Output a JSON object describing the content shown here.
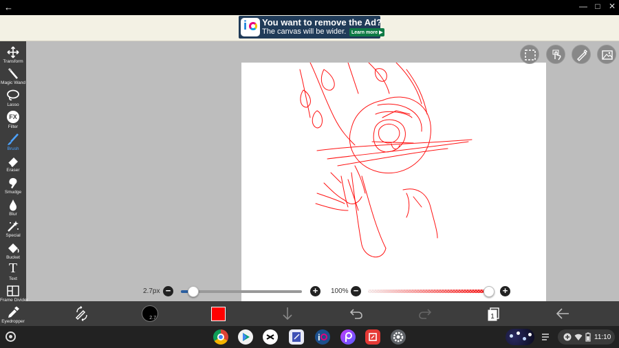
{
  "titlebar": {
    "back_glyph": "←",
    "minimize_glyph": "—",
    "maximize_glyph": "□",
    "close_glyph": "✕"
  },
  "ad": {
    "headline": "You want to remove the Ad?",
    "subline": "The canvas will be wider.",
    "cta": "Learn more ▶",
    "logo_letter": "i"
  },
  "tools": [
    {
      "label": "Transform",
      "icon": "move-arrows-icon",
      "active": false
    },
    {
      "label": "Magic Wand",
      "icon": "magic-wand-icon",
      "active": false
    },
    {
      "label": "Lasso",
      "icon": "lasso-icon",
      "active": false
    },
    {
      "label": "Filter",
      "icon": "fx-icon",
      "active": false
    },
    {
      "label": "Brush",
      "icon": "brush-icon",
      "active": true
    },
    {
      "label": "Eraser",
      "icon": "eraser-icon",
      "active": false
    },
    {
      "label": "Smudge",
      "icon": "smudge-icon",
      "active": false
    },
    {
      "label": "Blur",
      "icon": "drop-icon",
      "active": false
    },
    {
      "label": "Special",
      "icon": "sparkle-wand-icon",
      "active": false
    },
    {
      "label": "Bucket",
      "icon": "bucket-icon",
      "active": false
    },
    {
      "label": "Text",
      "icon": "text-t-icon",
      "active": false
    },
    {
      "label": "Frame Divider",
      "icon": "frame-divider-icon",
      "active": false
    },
    {
      "label": "Eyedropper",
      "icon": "eyedropper-icon",
      "active": false
    }
  ],
  "filter_glyph": "FX",
  "text_tool_glyph": "T",
  "right_icons": [
    "selection-icon",
    "hand-touch-icon",
    "pen-ruler-icon",
    "image-layer-icon"
  ],
  "brush_size": {
    "label": "2.7px",
    "fraction": 0.1
  },
  "opacity": {
    "label": "100%",
    "fraction": 1.0
  },
  "minus_glyph": "−",
  "plus_glyph": "+",
  "brush_disc_value": "2.7",
  "colors": {
    "brush_color": "#ff0000",
    "accent": "#4da3ff",
    "toolbar_bg": "#3d3d3d"
  },
  "bottom_bar_icons": [
    "brush-settings-icon",
    "brush-size-disc",
    "color-swatch",
    "download-arrow-icon",
    "undo-icon",
    "redo-icon",
    "layers-icon",
    "back-arrow-icon"
  ],
  "layers_count": "1",
  "shelf": {
    "apps": [
      "chrome-icon",
      "play-store-icon",
      "capcut-icon",
      "notes-app-icon",
      "ibispaint-icon",
      "picsart-icon",
      "screenshot-app-icon",
      "settings-icon"
    ],
    "clock": "11:10"
  }
}
